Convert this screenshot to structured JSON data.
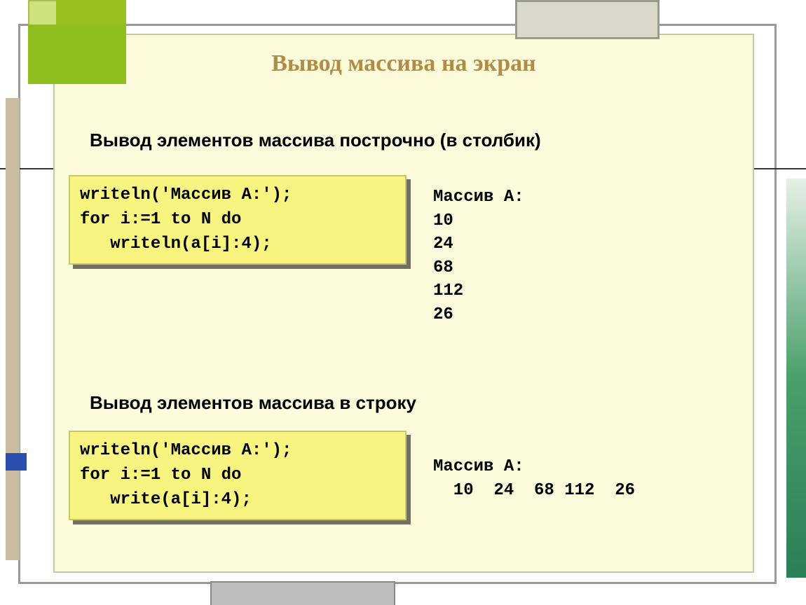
{
  "title": "Вывод массива на экран",
  "section1": {
    "heading": "Вывод элементов массива построчно (в столбик)",
    "code": "writeln('Массив A:');\nfor i:=1 to N do\n   writeln(a[i]:4);",
    "output": "Массив A:\n10\n24\n68\n112\n26"
  },
  "section2": {
    "heading": "Вывод элементов массива в строку",
    "code": "writeln('Массив A:');\nfor i:=1 to N do\n   write(a[i]:4);",
    "output": "Массив A:\n  10  24  68 112  26"
  }
}
